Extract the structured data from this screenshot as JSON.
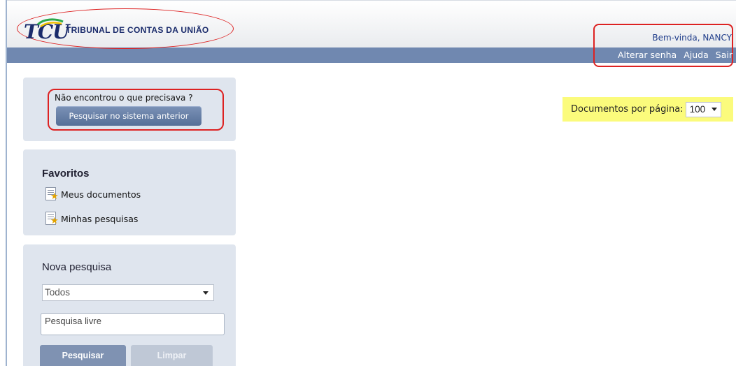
{
  "header": {
    "logo_mark": "TCU",
    "logo_text": "TRIBUNAL DE CONTAS DA UNIÃO",
    "welcome": "Bem-vinda, NANCY",
    "nav": [
      "Alterar senha",
      "Ajuda",
      "Sair"
    ]
  },
  "sidebar": {
    "legacy": {
      "question": "Não encontrou o que precisava ?",
      "button_label": "Pesquisar no sistema anterior"
    },
    "favorites": {
      "title": "Favoritos",
      "items": [
        "Meus documentos",
        "Minhas pesquisas"
      ]
    },
    "new_search": {
      "title": "Nova pesquisa",
      "scope_selected": "Todos",
      "free_text_value": "Pesquisa livre",
      "search_label": "Pesquisar",
      "clear_label": "Limpar"
    }
  },
  "main": {
    "docs_per_page_label": "Documentos por página:",
    "docs_per_page_value": "100"
  },
  "colors": {
    "navbar": "#7088b0",
    "panel": "#dfe5ee",
    "highlight": "#fbfb7c",
    "annotation": "#dd2222"
  }
}
